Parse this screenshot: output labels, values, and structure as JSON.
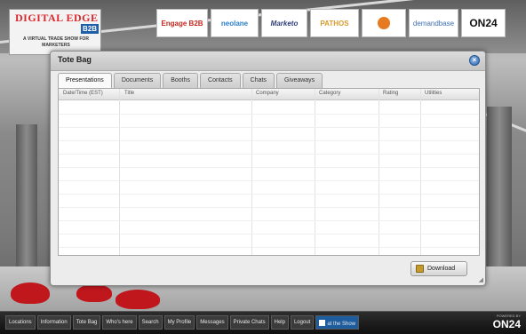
{
  "logo": {
    "title": "DIGITAL EDGE",
    "badge": "B2B",
    "subtitle": "A VIRTUAL TRADE SHOW FOR MARKETERS"
  },
  "sponsors": [
    {
      "name": "Engage B2B",
      "color": "#c3271f"
    },
    {
      "name": "neolane",
      "color": "#2a7fc9"
    },
    {
      "name": "Marketo",
      "color": "#2d3e7a"
    },
    {
      "name": "PATHOS",
      "color": "#d79b2d"
    },
    {
      "name": "",
      "color": "#e57a1e"
    },
    {
      "name": "demandbase",
      "color": "#3e6fb0"
    },
    {
      "name": "ON24",
      "color": "#111111"
    }
  ],
  "window": {
    "title": "Tote Bag",
    "tabs": [
      "Presentations",
      "Documents",
      "Booths",
      "Contacts",
      "Chats",
      "Giveaways"
    ],
    "active_tab": "Presentations",
    "columns": [
      "Date/Time (EST)",
      "Title",
      "Company",
      "Category",
      "Rating",
      "Utilities"
    ],
    "download_label": "Download"
  },
  "nav": {
    "items": [
      "Locations",
      "Information",
      "Tote Bag",
      "Who's here",
      "Search",
      "My Profile",
      "Messages",
      "Private Chats",
      "Help",
      "Logout",
      "at the Show"
    ],
    "brand_top": "POWERED BY",
    "brand_name": "ON24"
  },
  "colors": {
    "accent": "#1f5ea8",
    "close_button": "#2e67b7"
  }
}
